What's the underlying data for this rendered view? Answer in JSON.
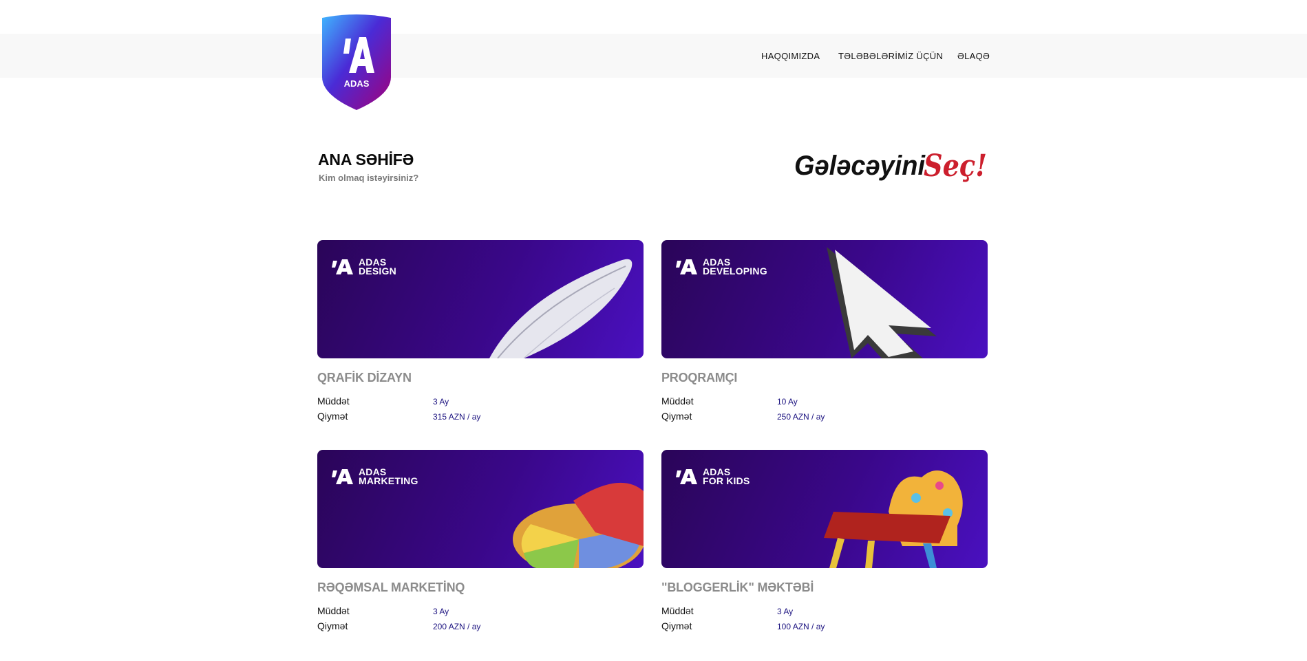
{
  "brand": {
    "logo_text": "ADAS"
  },
  "nav": {
    "items": [
      "HAQQIMIZDA",
      "TƏLƏBƏLƏRİMİZ ÜÇÜN",
      "ƏLAQƏ"
    ]
  },
  "header": {
    "title": "ANA SƏHİFƏ",
    "subtitle": "Kim olmaq istəyirsiniz?",
    "slogan_part1": "Gələcəyini",
    "slogan_part2": "Seç!"
  },
  "labels": {
    "duration": "Müddət",
    "price": "Qiymət"
  },
  "colors": {
    "accent_purple": "#3a078a",
    "slogan_red": "#cc1f2d",
    "price_text": "#1c1380"
  },
  "courses": [
    {
      "banner_line1": "ADAS",
      "banner_line2": "DESIGN",
      "banner_icon": "feather-icon",
      "title": "QRAFİK DİZAYN",
      "duration": "3 Ay",
      "price": "315 AZN / ay"
    },
    {
      "banner_line1": "ADAS",
      "banner_line2": "DEVELOPING",
      "banner_icon": "cursor-icon",
      "title": "PROQRAMÇI",
      "duration": "10 Ay",
      "price": "250 AZN / ay"
    },
    {
      "banner_line1": "ADAS",
      "banner_line2": "MARKETING",
      "banner_icon": "pie-chart-icon",
      "title": "RƏQƏMSAL MARKETİNQ",
      "duration": "3 Ay",
      "price": "200 AZN / ay"
    },
    {
      "banner_line1": "ADAS",
      "banner_line2": "FOR KIDS",
      "banner_icon": "kids-chair-icon",
      "title": "\"BLOGGERLİK\" MƏKTƏBİ",
      "duration": "3 Ay",
      "price": "100 AZN / ay"
    }
  ]
}
